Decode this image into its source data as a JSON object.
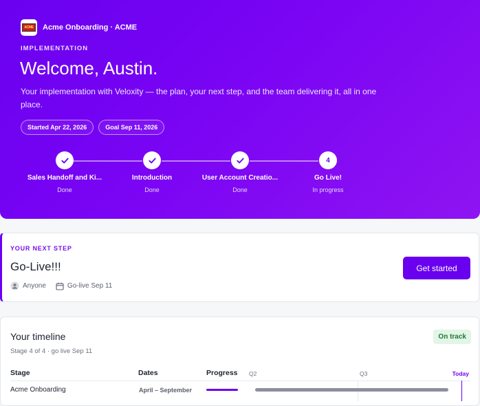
{
  "header": {
    "org_label": "Acme Onboarding · ACME",
    "logo_text": "ACME",
    "eyebrow": "IMPLEMENTATION",
    "welcome": "Welcome, Austin.",
    "intro": "Your implementation with Veloxity — the plan, your next step, and the team delivering it, all in one place.",
    "started": "Started Apr 22, 2026",
    "goal": "Goal Sep 11, 2026"
  },
  "stepper": [
    {
      "name": "Sales Handoff and Ki...",
      "status": "Done",
      "icon": "check-icon",
      "number": ""
    },
    {
      "name": "Introduction",
      "status": "Done",
      "icon": "check-icon",
      "number": ""
    },
    {
      "name": "User Account Creatio...",
      "status": "Done",
      "icon": "check-icon",
      "number": ""
    },
    {
      "name": "Go Live!",
      "status": "In progress",
      "icon": "",
      "number": "4"
    }
  ],
  "next_step": {
    "eyebrow": "YOUR NEXT STEP",
    "title": "Go-Live!!!",
    "owner": "Anyone",
    "due": "Go-live Sep 11",
    "button": "Get started"
  },
  "timeline": {
    "title": "Your timeline",
    "subtitle": "Stage 4 of 4 · go live Sep 11",
    "status_badge": "On track",
    "columns": [
      "Stage",
      "Dates",
      "Progress"
    ],
    "quarters": [
      "Q2",
      "Q3"
    ],
    "today_label": "Today",
    "rows": [
      {
        "stage": "Acme Onboarding",
        "dates": "April – September",
        "progress": 1.0
      }
    ]
  },
  "colors": {
    "accent": "#6a00f0",
    "success_bg": "#e2f5e6",
    "success_text": "#1d7a35"
  }
}
